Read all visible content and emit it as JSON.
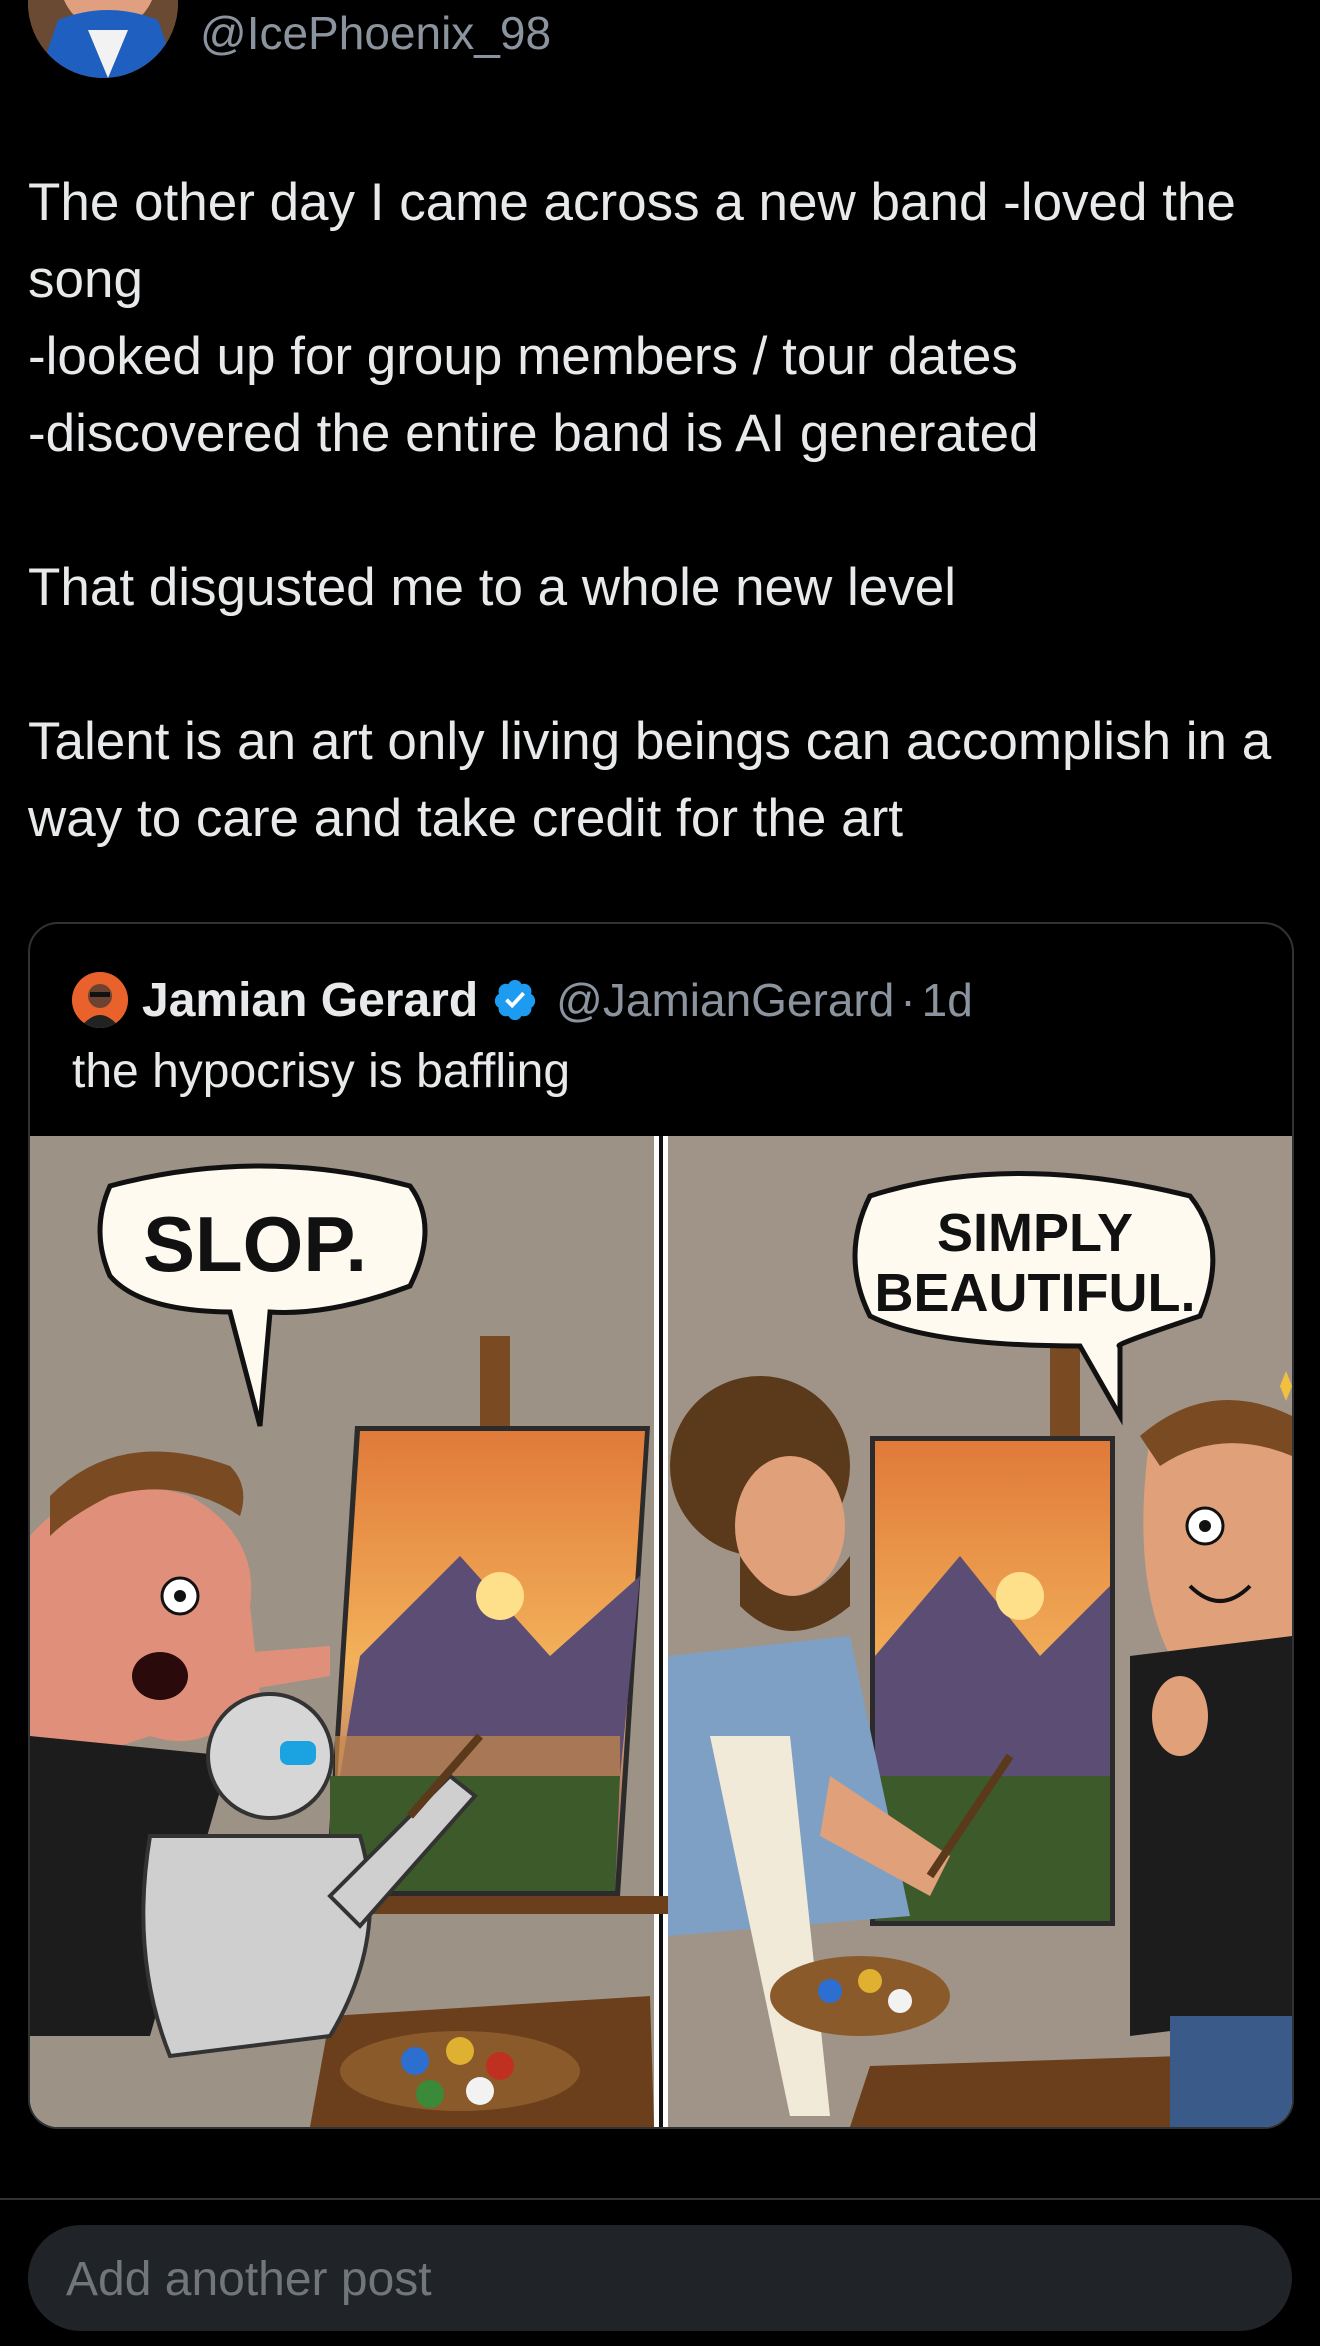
{
  "author": {
    "handle": "@IcePhoenix_98"
  },
  "post": {
    "lines": [
      "The other day I came across a new band -loved the song",
      "-looked up for group members / tour dates",
      "-discovered the entire band is AI generated",
      "That disgusted me to a whole new level",
      "Talent is an art only living beings can accomplish in a way to care and take credit for the art"
    ]
  },
  "quote": {
    "name": "Jamian Gerard",
    "handle": "@JamianGerard",
    "separator": "·",
    "time": "1d",
    "text": "the hypocrisy is baffling",
    "image": {
      "left_bubble": "SLOP.",
      "right_bubble_line1": "SIMPLY",
      "right_bubble_line2": "BEAUTIFUL."
    }
  },
  "composer": {
    "placeholder": "Add another post"
  },
  "colors": {
    "background": "#000000",
    "text": "#e7e9ea",
    "muted": "#8b949e",
    "verified": "#1d9bf0",
    "border": "#2f3336",
    "composer_bg": "#202327"
  },
  "icons": [
    "avatar",
    "verified-badge-icon"
  ]
}
